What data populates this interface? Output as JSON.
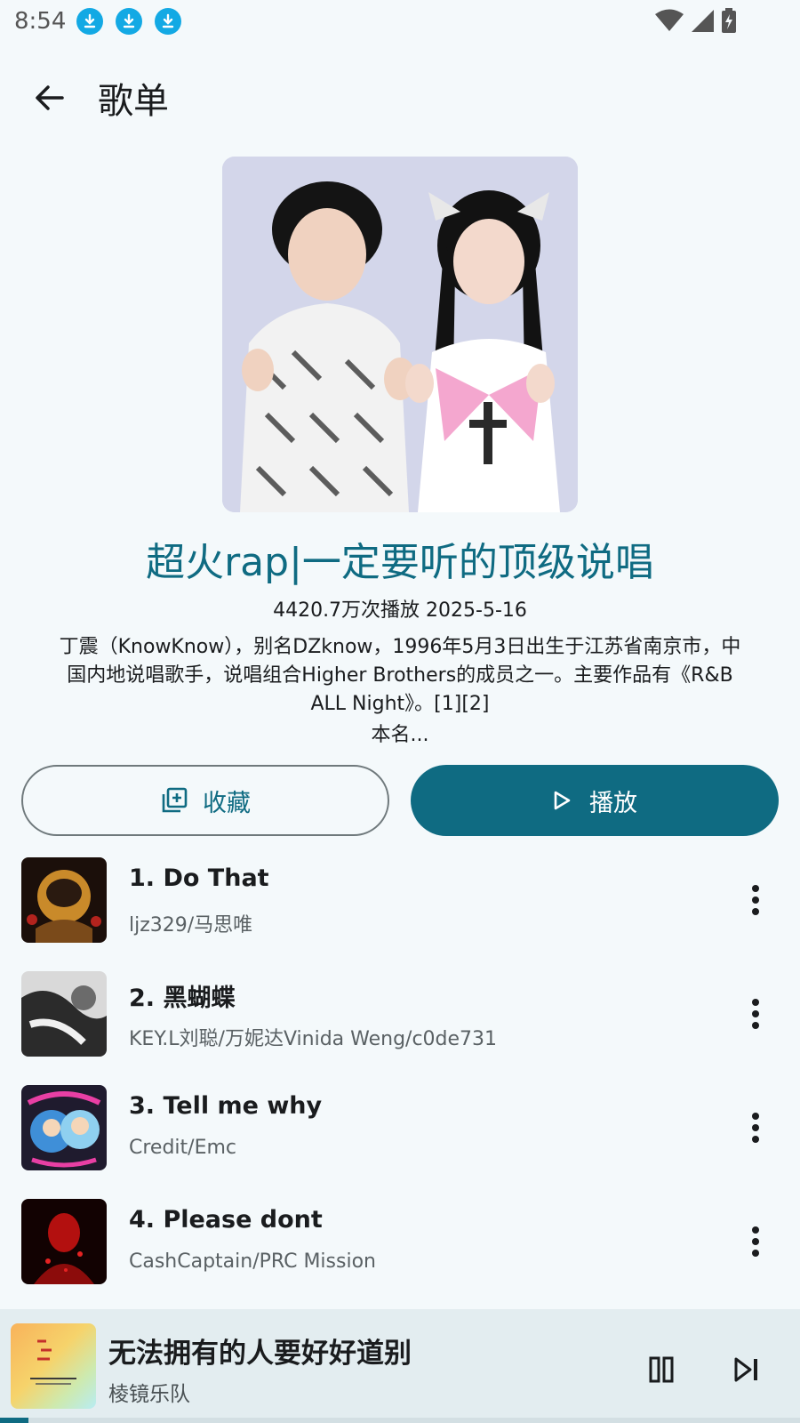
{
  "status": {
    "time": "8:54"
  },
  "header": {
    "title": "歌单"
  },
  "playlist": {
    "title": "超火rap|一定要听的顶级说唱",
    "meta": "4420.7万次播放 2025-5-16",
    "description": "丁震（KnowKnow），别名DZknow，1996年5月3日出生于江苏省南京市，中国内地说唱歌手，说唱组合Higher Brothers的成员之一。主要作品有《R&B ALL Night》。[1][2]",
    "description_more": "本名..."
  },
  "actions": {
    "favorite_label": "收藏",
    "play_label": "播放"
  },
  "songs": [
    {
      "title": "1. Do That",
      "artist": "ljz329/马思唯"
    },
    {
      "title": "2. 黑蝴蝶",
      "artist": "KEY.L刘聪/万妮达Vinida Weng/c0de731"
    },
    {
      "title": "3. Tell me why",
      "artist": "Credit/Emc"
    },
    {
      "title": "4. Please dont",
      "artist": "CashCaptain/PRC Mission"
    }
  ],
  "now_playing": {
    "title": "无法拥有的人要好好道别",
    "artist": "棱镜乐队",
    "progress": 0.035
  },
  "colors": {
    "accent": "#0f6b82",
    "background": "#f4f9fb",
    "mini_player_bg": "#e3edf0"
  }
}
